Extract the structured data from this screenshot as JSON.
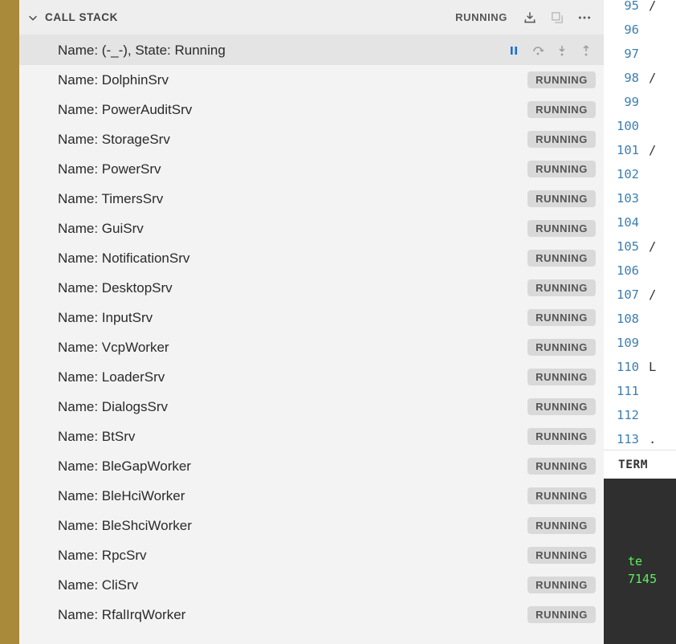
{
  "panel": {
    "title": "CALL STACK",
    "status": "RUNNING"
  },
  "primary": {
    "label": "Name: (-_-), State: Running"
  },
  "threads": [
    {
      "name": "DolphinSrv",
      "state": "RUNNING"
    },
    {
      "name": "PowerAuditSrv",
      "state": "RUNNING"
    },
    {
      "name": "StorageSrv",
      "state": "RUNNING"
    },
    {
      "name": "PowerSrv",
      "state": "RUNNING"
    },
    {
      "name": "TimersSrv",
      "state": "RUNNING"
    },
    {
      "name": "GuiSrv",
      "state": "RUNNING"
    },
    {
      "name": "NotificationSrv",
      "state": "RUNNING"
    },
    {
      "name": "DesktopSrv",
      "state": "RUNNING"
    },
    {
      "name": "InputSrv",
      "state": "RUNNING"
    },
    {
      "name": "VcpWorker",
      "state": "RUNNING"
    },
    {
      "name": "LoaderSrv",
      "state": "RUNNING"
    },
    {
      "name": "DialogsSrv",
      "state": "RUNNING"
    },
    {
      "name": "BtSrv",
      "state": "RUNNING"
    },
    {
      "name": "BleGapWorker",
      "state": "RUNNING"
    },
    {
      "name": "BleHciWorker",
      "state": "RUNNING"
    },
    {
      "name": "BleShciWorker",
      "state": "RUNNING"
    },
    {
      "name": "RpcSrv",
      "state": "RUNNING"
    },
    {
      "name": "CliSrv",
      "state": "RUNNING"
    },
    {
      "name": "RfalIrqWorker",
      "state": "RUNNING"
    }
  ],
  "editor": {
    "line_start": 95,
    "line_end": 113,
    "slash_lines": [
      95,
      98,
      101,
      105,
      107
    ],
    "code_fragments": {
      "110": "L",
      "113": "."
    }
  },
  "terminal": {
    "tab_label": "TERM",
    "lines": [
      "te",
      "7145"
    ]
  }
}
